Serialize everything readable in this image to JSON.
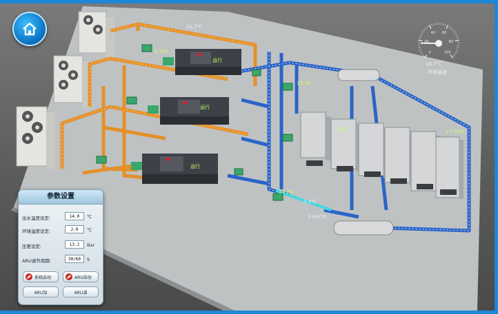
{
  "home": {
    "icon": "home-icon"
  },
  "gauge": {
    "value": "16.7℃",
    "caption": "环境温度",
    "ticks": [
      "0",
      "20",
      "40",
      "60",
      "80",
      "100"
    ],
    "level_fraction": 0.17
  },
  "scene_labels": {
    "top_pipe": "21.7℃",
    "pump_top": "2.73h",
    "chiller1": "运行",
    "chiller2": "运行",
    "chiller3": "运行",
    "flow_right": "13.2B",
    "flow_left": "13.2B",
    "tank_temp": "3.4℃",
    "flow_mid": "3.0m³/h",
    "pressure_right": "11.0bar",
    "cooler_tag": "运行"
  },
  "panel": {
    "title": "参数设置",
    "rows": [
      {
        "label": "出水温度设定:",
        "value": "14.0",
        "unit": "℃"
      },
      {
        "label": "环境温度设定:",
        "value": "2.0",
        "unit": "℃"
      },
      {
        "label": "压差设定:",
        "value": "13.2",
        "unit": "Bar"
      },
      {
        "label": "ARU调节周期:",
        "value": "30/60",
        "unit": "S"
      }
    ],
    "buttons": {
      "system_start": "系统启动",
      "aru_auto": "ARU自动",
      "aru_add": "ARU加",
      "aru_minus": "ARU减"
    },
    "colors": {
      "stop_red": "#d0261e"
    }
  },
  "colors": {
    "frame_border": "#1e86d6",
    "chilled_water": "#2a64c8",
    "cooling_water": "#e4902a",
    "label_green": "#c8ff6a"
  }
}
